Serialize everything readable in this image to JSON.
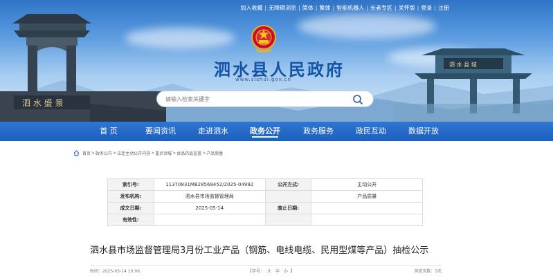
{
  "colors": {
    "nav_bg": "#1d5fbd",
    "title": "#1553a8",
    "banner_sky": "#5b9be0"
  },
  "top_links": [
    "加入收藏",
    "无障碍浏览",
    "简体",
    "繁体",
    "智能机器人",
    "长者专区",
    "关怀版",
    "登录",
    "注册"
  ],
  "site": {
    "title": "泗水县人民政府",
    "url": "www.sishui.gov.cn",
    "emblem": "national-emblem-icon"
  },
  "search": {
    "placeholder": "请输入检索关键字",
    "value": ""
  },
  "nav": {
    "items": [
      "首 页",
      "要闻资讯",
      "走进泗水",
      "政务公开",
      "政务服务",
      "政民互动",
      "数据开放"
    ],
    "active_index": 3
  },
  "breadcrumb": [
    "首页",
    "政务公开",
    "法定主动公开内容",
    "重点领域",
    "食品药品监管",
    "产品质量"
  ],
  "info": {
    "rows": [
      {
        "l1": "索引号:",
        "v1": "11370831MB28569452/2025-04992",
        "l2": "公开方式:",
        "v2": "主动公开"
      },
      {
        "l1": "发布机构:",
        "v1": "泗水县市场监督管理局",
        "l2": "",
        "v2": "产品质量"
      },
      {
        "l1": "成文日期:",
        "v1": "2025-05-14",
        "l2": "废止日期:",
        "v2": ""
      },
      {
        "l1": "有效性:",
        "v1": "",
        "l2": "",
        "v2": ""
      }
    ]
  },
  "article": {
    "title": "泗水县市场监督管理局3月份工业产品（钢筋、电线电缆、民用型煤等产品）抽检公示",
    "time": "时间：2025-05-14 10:06",
    "font_label": "【字号：",
    "sizes": [
      "大",
      "中",
      "小"
    ],
    "font_close": "】",
    "views": "浏览次数：3次"
  }
}
